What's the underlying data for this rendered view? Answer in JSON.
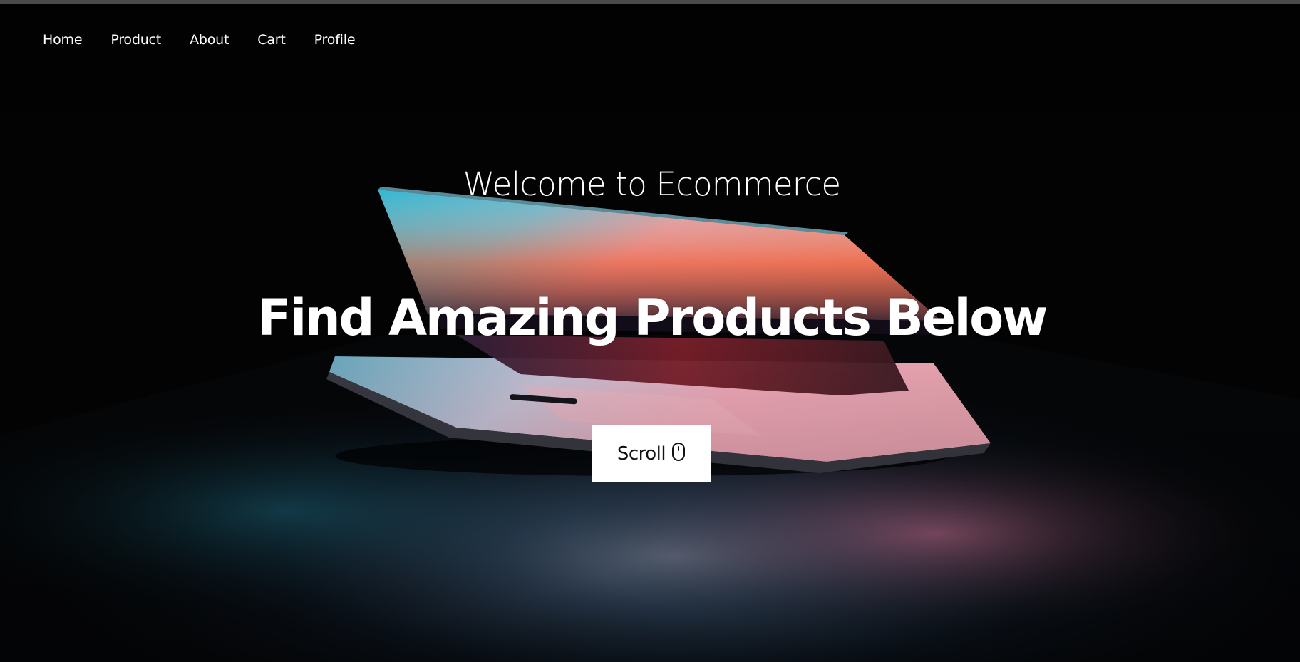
{
  "nav": {
    "items": [
      {
        "label": "Home"
      },
      {
        "label": "Product"
      },
      {
        "label": "About"
      },
      {
        "label": "Cart"
      },
      {
        "label": "Profile"
      }
    ]
  },
  "hero": {
    "welcome": "Welcome to Ecommerce",
    "headline": "Find Amazing Products Below",
    "scroll_label": "Scroll",
    "scroll_icon": "mouse-icon",
    "background_image": "laptop-half-open-photo"
  },
  "colors": {
    "background": "#040404",
    "text": "#ffffff",
    "button_background": "#ffffff",
    "button_text": "#111111",
    "screen_cyan": "#1fb8d8",
    "screen_orange": "#ff6a2a",
    "screen_pink": "#f0b0c0",
    "top_border": "#4a4a4a"
  }
}
